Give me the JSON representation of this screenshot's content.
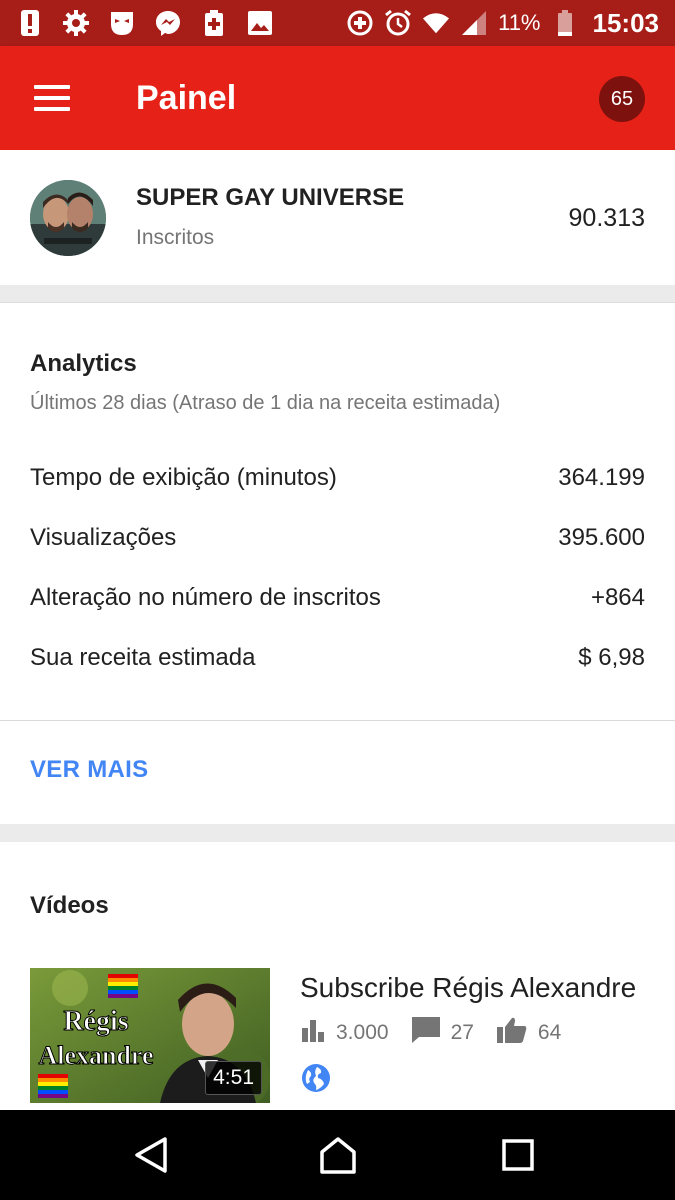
{
  "status_bar": {
    "icons": [
      "alert-icon",
      "gear-icon",
      "mask-app-icon",
      "messenger-icon",
      "battery-saver-icon",
      "image-icon",
      "data-saver-icon",
      "alarm-icon",
      "wifi-icon",
      "signal-icon",
      "battery-icon"
    ],
    "battery": "11%",
    "time": "15:03"
  },
  "app_bar": {
    "title": "Painel",
    "notification_count": "65"
  },
  "channel": {
    "name": "SUPER GAY UNIVERSE",
    "subtitle": "Inscritos",
    "subscribers": "90.313"
  },
  "analytics": {
    "title": "Analytics",
    "subtitle": "Últimos 28 dias (Atraso de 1 dia na receita estimada)",
    "metrics": [
      {
        "label": "Tempo de exibição (minutos)",
        "value": "364.199"
      },
      {
        "label": "Visualizações",
        "value": "395.600"
      },
      {
        "label": "Alteração no número de inscritos",
        "value": "+864"
      },
      {
        "label": "Sua receita estimada",
        "value": "$ 6,98"
      }
    ],
    "more_label": "VER MAIS"
  },
  "videos": {
    "title": "Vídeos",
    "items": [
      {
        "title": "Subscribe Régis Alexandre",
        "duration": "4:51",
        "views": "3.000",
        "comments": "27",
        "likes": "64",
        "thumbnail_text": [
          "Régis",
          "Alexandre"
        ]
      }
    ]
  },
  "colors": {
    "status_bar": "#a71d17",
    "app_bar": "#e62117",
    "badge": "#7c110d",
    "link": "#4285f4",
    "muted_text": "#757575"
  }
}
